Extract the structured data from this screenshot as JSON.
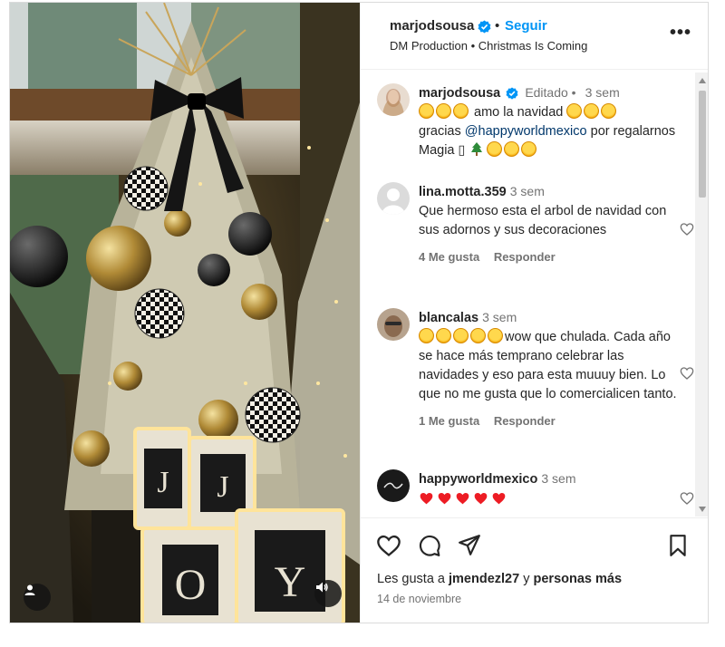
{
  "header": {
    "username": "marjodsousa",
    "dot": "•",
    "follow_label": "Seguir",
    "subtitle": "DM Production • Christmas Is Coming",
    "more_label": "•••"
  },
  "caption": {
    "username": "marjodsousa",
    "edited": "Editado •",
    "time": "3 sem",
    "text_a": "amo la navidad",
    "text_b": "gracias",
    "mention": "@happyworldmexico",
    "text_c": "por regalarnos Magia",
    "placeholder_glyph": "▯"
  },
  "comments": [
    {
      "username": "lina.motta.359",
      "time": "3 sem",
      "text": "Que hermoso esta el arbol de navidad con sus adornos y sus decoraciones",
      "likes": "4 Me gusta",
      "reply": "Responder"
    },
    {
      "username": "blancalas",
      "time": "3 sem",
      "text": "wow que chulada. Cada año se hace más temprano celebrar las navidades y eso para esta muuuy bien. Lo que no me gusta que lo comercialicen tanto.",
      "likes": "1 Me gusta",
      "reply": "Responder"
    },
    {
      "username": "happyworldmexico",
      "time": "3 sem"
    }
  ],
  "footer": {
    "likes_prefix": "Les gusta a",
    "likes_user": "jmendezl27",
    "likes_middle": "y",
    "likes_suffix": "personas más",
    "date": "14 de noviembre"
  },
  "media": {
    "letters": [
      "J",
      "J",
      "O",
      "Y"
    ]
  },
  "colors": {
    "follow": "#0095f6",
    "verified": "#0095f6",
    "heart": "#ed1c24",
    "muted_text": "#737373"
  },
  "icons": [
    "verified-badge-icon",
    "more-options-icon",
    "heart-icon",
    "comment-icon",
    "share-icon",
    "bookmark-icon",
    "user-tag-icon",
    "mute-icon",
    "star-eyes-emoji-icon",
    "red-heart-emoji-icon",
    "christmas-tree-emoji-icon"
  ]
}
